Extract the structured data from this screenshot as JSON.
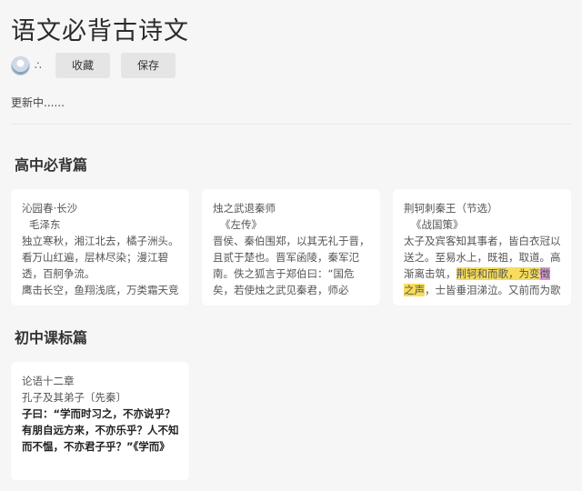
{
  "page": {
    "title": "语文必背古诗文",
    "update_text": "更新中......",
    "toolbar": {
      "more_glyph": "∴",
      "collect_label": "收藏",
      "save_label": "保存"
    }
  },
  "sections": [
    {
      "title": "高中必背篇",
      "cards": [
        {
          "title": "沁园春·长沙",
          "author": "  毛泽东",
          "lines": [
            "独立寒秋，湘江北去，橘子洲头。",
            "看万山红遍，层林尽染；漫江碧",
            "透，百舸争流。",
            "鹰击长空，鱼翔浅底，万类霜天竞"
          ]
        },
        {
          "title": "烛之武退秦师",
          "author": "  《左传》",
          "lines": [
            "晋侯、秦伯围郑，以其无礼于晋，",
            "且贰于楚也。晋军函陵，秦军氾",
            "南。佚之狐言于郑伯曰：“国危",
            "矣，若使烛之武见秦君，师必"
          ]
        },
        {
          "title": "荆轲刺秦王（节选）",
          "author": "  《战国策》",
          "lines": [
            "太子及宾客知其事者，皆白衣冠以",
            "送之。至易水上，既祖，取道。高"
          ],
          "line3_pre": "渐离击筑，",
          "line3_hl": "荆轲和而歌，为变",
          "line3_hl2": "徵",
          "line4_hl": "之声",
          "line4_post": "，士皆垂泪涕泣。又前而为歌"
        }
      ]
    },
    {
      "title": "初中课标篇",
      "cards": [
        {
          "title": "论语十二章",
          "author": "孔子及其弟子〔先秦〕",
          "lines": [
            "子曰：“学而时习之，不亦说乎？",
            "有朋自远方来，不亦乐乎？人不知",
            "而不愠，不亦君子乎？”《学而》"
          ]
        }
      ]
    }
  ]
}
